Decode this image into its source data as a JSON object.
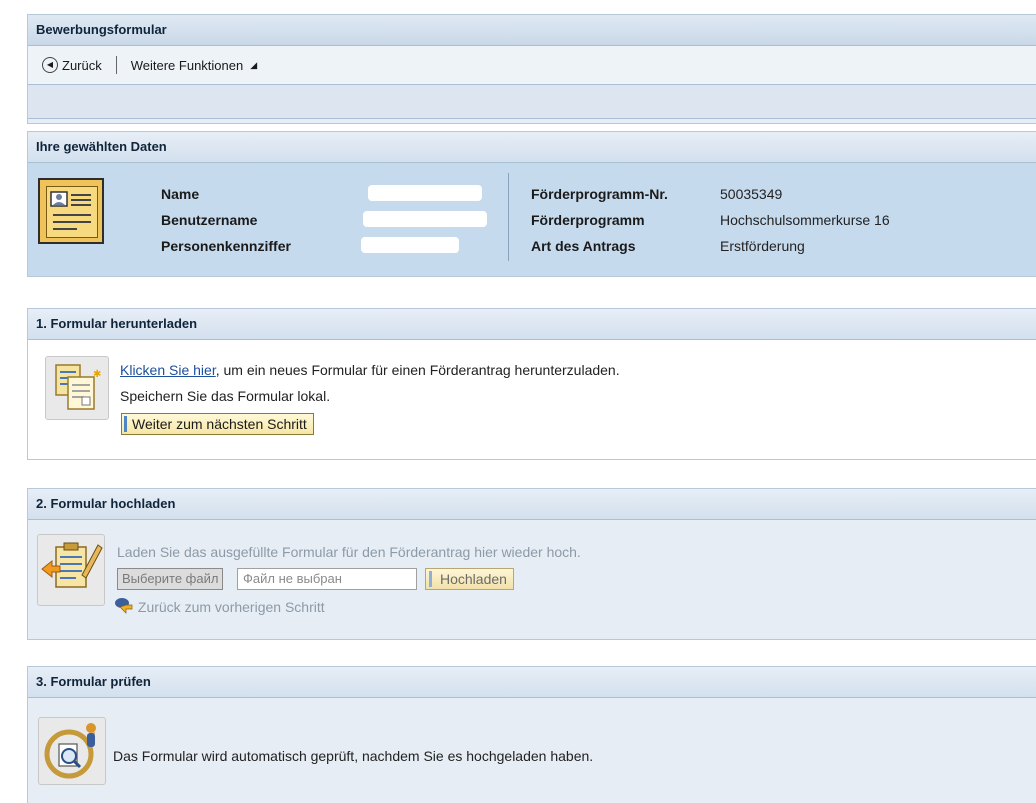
{
  "header": {
    "title": "Bewerbungsformular",
    "back_label": "Zurück",
    "more_label": "Weitere Funktionen"
  },
  "selected": {
    "title": "Ihre gewählten Daten",
    "left_fields": [
      {
        "label": "Name"
      },
      {
        "label": "Benutzername"
      },
      {
        "label": "Personenkennziffer"
      }
    ],
    "right_fields": [
      {
        "label": "Förderprogramm-Nr.",
        "value": "50035349"
      },
      {
        "label": "Förderprogramm",
        "value": "Hochschulsommerkurse 16"
      },
      {
        "label": "Art des Antrags",
        "value": "Erstförderung"
      }
    ]
  },
  "step1": {
    "title": "1. Formular herunterladen",
    "link": "Klicken Sie hier",
    "text_after_link": ", um ein neues Formular für einen Förderantrag herunterzuladen.",
    "line2": "Speichern Sie das Formular lokal.",
    "button": "Weiter zum nächsten Schritt"
  },
  "step2": {
    "title": "2. Formular hochladen",
    "line1": "Laden Sie das ausgefüllte Formular für den Förderantrag hier wieder hoch.",
    "file_button": "Выберите файл",
    "file_status": "Файл не выбран",
    "upload_button": "Hochladen",
    "back_link": "Zurück zum vorherigen Schritt"
  },
  "step3": {
    "title": "3. Formular prüfen",
    "line1": "Das Formular wird automatisch geprüft, nachdem Sie es hochgeladen haben."
  },
  "colors": {
    "accent_blue": "#1c4f9c",
    "panel_blue": "#c6daee",
    "button_yellow": "#f6e6a5"
  }
}
